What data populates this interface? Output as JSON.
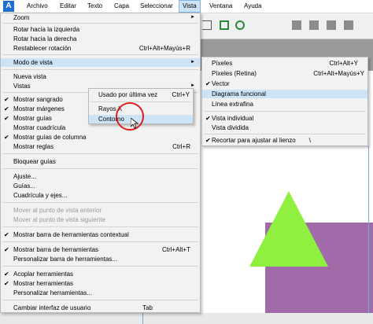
{
  "menubar": {
    "items": [
      {
        "label": "Archivo"
      },
      {
        "label": "Editar"
      },
      {
        "label": "Texto"
      },
      {
        "label": "Capa"
      },
      {
        "label": "Seleccionar"
      },
      {
        "label": "Vista"
      },
      {
        "label": "Ventana"
      },
      {
        "label": "Ayuda"
      }
    ]
  },
  "vista_menu": {
    "items": [
      {
        "label": "Zoom",
        "shortcut": "",
        "submenu": true
      },
      {
        "label": "Rotar hacia la izquierda",
        "shortcut": ""
      },
      {
        "label": "Rotar hacia la derecha",
        "shortcut": ""
      },
      {
        "label": "Restablecer rotación",
        "shortcut": "Ctrl+Alt+Mayús+R"
      },
      {
        "label": "Modo de vista",
        "shortcut": "",
        "submenu": true
      },
      {
        "label": "Nueva vista",
        "shortcut": ""
      },
      {
        "label": "Vistas",
        "shortcut": "",
        "submenu": true
      },
      {
        "label": "Mostrar sangrado",
        "shortcut": ""
      },
      {
        "label": "Mostrar márgenes",
        "shortcut": ""
      },
      {
        "label": "Mostrar guías",
        "shortcut": ""
      },
      {
        "label": "Mostrar cuadrícula",
        "shortcut": ""
      },
      {
        "label": "Mostrar guías de columna",
        "shortcut": ""
      },
      {
        "label": "Mostrar reglas",
        "shortcut": "Ctrl+R"
      },
      {
        "label": "Bloquear guías",
        "shortcut": ""
      },
      {
        "label": "Ajuste...",
        "shortcut": ""
      },
      {
        "label": "Guías...",
        "shortcut": ""
      },
      {
        "label": "Cuadrícula y ejes...",
        "shortcut": ""
      },
      {
        "label": "Mover al punto de vista anterior",
        "shortcut": ""
      },
      {
        "label": "Mover al punto de vista siguiente",
        "shortcut": ""
      },
      {
        "label": "Mostrar barra de herramientas contextual",
        "shortcut": ""
      },
      {
        "label": "Mostrar barra de herramientas",
        "shortcut": "Ctrl+Alt+T"
      },
      {
        "label": "Personalizar barra de herramientas...",
        "shortcut": ""
      },
      {
        "label": "Acoplar herramientas",
        "shortcut": ""
      },
      {
        "label": "Mostrar herramientas",
        "shortcut": ""
      },
      {
        "label": "Personalizar herramientas...",
        "shortcut": ""
      },
      {
        "label": "Cambiar interfaz de usuario",
        "shortcut": "Tab"
      }
    ],
    "checkmark": "✔",
    "submenu_arrow": "►"
  },
  "vistas_submenu": {
    "items": [
      {
        "label": "Usado por última vez",
        "shortcut": "Ctrl+Y"
      },
      {
        "label": "Rayos X",
        "shortcut": ""
      },
      {
        "label": "Contorno",
        "shortcut": ""
      }
    ]
  },
  "view_mode_submenu": {
    "items": [
      {
        "label": "Píxeles",
        "shortcut": "Ctrl+Alt+Y"
      },
      {
        "label": "Píxeles (Retina)",
        "shortcut": "Ctrl+Alt+Mayús+Y"
      },
      {
        "label": "Vector",
        "shortcut": ""
      },
      {
        "label": "Diagrama funcional",
        "shortcut": ""
      },
      {
        "label": "Línea extrafina",
        "shortcut": ""
      },
      {
        "label": "Vista individual",
        "shortcut": ""
      },
      {
        "label": "Vista dividida",
        "shortcut": ""
      },
      {
        "label": "Recortar para ajustar al lienzo",
        "shortcut": "\\"
      }
    ]
  },
  "colors": {
    "menu_highlight": "#cde4f7",
    "canvas_rect": "#a16aa8",
    "canvas_triangle": "#8ff040",
    "annotation_circle": "#e02020"
  }
}
